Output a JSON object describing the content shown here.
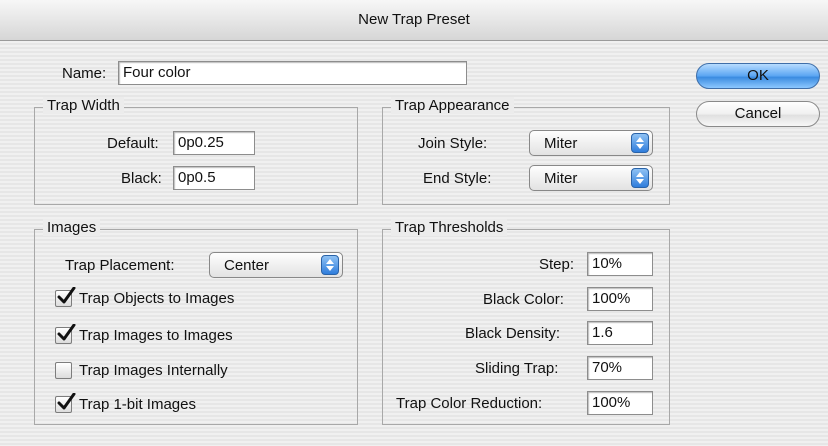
{
  "window": {
    "title": "New Trap Preset"
  },
  "name": {
    "label": "Name:",
    "value": "Four color"
  },
  "buttons": {
    "ok": "OK",
    "cancel": "Cancel"
  },
  "trap_width": {
    "title": "Trap Width",
    "default_label": "Default:",
    "default_value": "0p0.25",
    "black_label": "Black:",
    "black_value": "0p0.5"
  },
  "trap_appearance": {
    "title": "Trap Appearance",
    "join_label": "Join Style:",
    "join_value": "Miter",
    "end_label": "End Style:",
    "end_value": "Miter"
  },
  "images": {
    "title": "Images",
    "placement_label": "Trap Placement:",
    "placement_value": "Center",
    "checkboxes": [
      {
        "label": "Trap Objects to Images",
        "checked": true
      },
      {
        "label": "Trap Images to Images",
        "checked": true
      },
      {
        "label": "Trap Images Internally",
        "checked": false
      },
      {
        "label": "Trap 1-bit Images",
        "checked": true
      }
    ]
  },
  "thresholds": {
    "title": "Trap Thresholds",
    "step_label": "Step:",
    "step_value": "10%",
    "black_color_label": "Black Color:",
    "black_color_value": "100%",
    "black_density_label": "Black Density:",
    "black_density_value": "1.6",
    "sliding_label": "Sliding Trap:",
    "sliding_value": "70%",
    "reduction_label": "Trap Color Reduction:",
    "reduction_value": "100%"
  }
}
